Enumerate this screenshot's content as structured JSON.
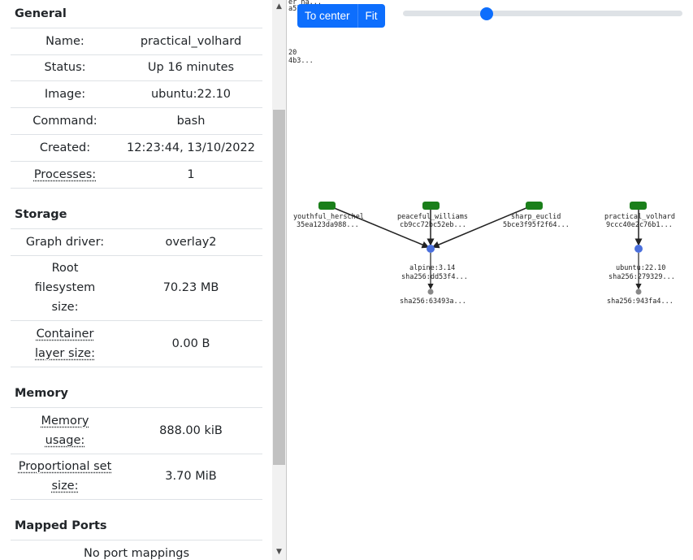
{
  "panel": {
    "general": {
      "title": "General",
      "rows": [
        {
          "key": "Name:",
          "value": "practical_volhard"
        },
        {
          "key": "Status:",
          "value": "Up 16 minutes"
        },
        {
          "key": "Image:",
          "value": "ubuntu:22.10"
        },
        {
          "key": "Command:",
          "value": "bash"
        },
        {
          "key": "Created:",
          "value": "12:23:44, 13/10/2022"
        },
        {
          "key": "Processes:",
          "value": "1"
        }
      ]
    },
    "storage": {
      "title": "Storage",
      "rows": [
        {
          "key": "Graph driver:",
          "value": "overlay2"
        },
        {
          "key": "Root filesystem size:",
          "value": "70.23 MB"
        },
        {
          "key": "Container layer size:",
          "value": "0.00 B"
        }
      ]
    },
    "memory": {
      "title": "Memory",
      "rows": [
        {
          "key": "Memory usage:",
          "value": "888.00 kiB"
        },
        {
          "key": "Proportional set size:",
          "value": "3.70 MiB"
        }
      ]
    },
    "ports": {
      "title": "Mapped Ports",
      "empty_text": "No port mappings"
    }
  },
  "toolbar": {
    "center_label": "To center",
    "fit_label": "Fit",
    "zoom_level": 0.3
  },
  "graph": {
    "partial_top": [
      "er_ha...",
      "a5...",
      "20",
      "4b3..."
    ],
    "containers": [
      {
        "name": "youthful_herschel",
        "id": "35ea123da988..."
      },
      {
        "name": "peaceful_williams",
        "id": "cb9cc72bc52eb..."
      },
      {
        "name": "sharp_euclid",
        "id": "5bce3f95f2f64..."
      },
      {
        "name": "practical_volhard",
        "id": "9ccc40e2c76b1..."
      }
    ],
    "images": [
      {
        "name": "alpine:3.14",
        "id": "sha256:dd53f4...",
        "layer": "sha256:63493a..."
      },
      {
        "name": "ubuntu:22.10",
        "id": "sha256:279329...",
        "layer": "sha256:943fa4..."
      }
    ],
    "colors": {
      "container": "#1a7f1a",
      "image": "#4a6fdc",
      "layer": "#888888",
      "edge": "#222222"
    }
  }
}
